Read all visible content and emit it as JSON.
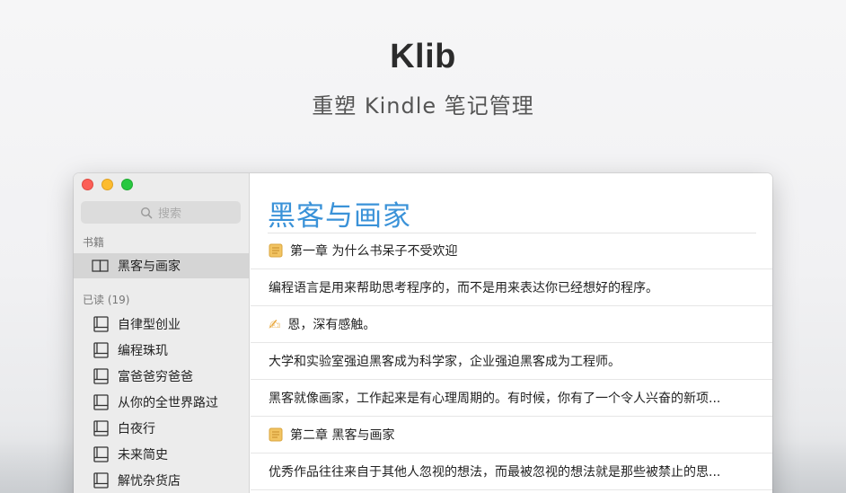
{
  "hero": {
    "title": "Klib",
    "subtitle": "重塑 Kindle 笔记管理"
  },
  "sidebar": {
    "search_placeholder": "搜索",
    "books_section": "书籍",
    "current_book": "黑客与画家",
    "read_section": "已读 (19)",
    "read_books": [
      "自律型创业",
      "编程珠玑",
      "富爸爸穷爸爸",
      "从你的全世界路过",
      "白夜行",
      "未来简史",
      "解忧杂货店"
    ]
  },
  "main": {
    "book_title": "黑客与画家",
    "rows": [
      {
        "type": "chapter",
        "text": "第一章 为什么书呆子不受欢迎"
      },
      {
        "type": "highlight",
        "text": "编程语言是用来帮助思考程序的，而不是用来表达你已经想好的程序。"
      },
      {
        "type": "note",
        "text": "恩，深有感触。"
      },
      {
        "type": "highlight",
        "text": "大学和实验室强迫黑客成为科学家，企业强迫黑客成为工程师。"
      },
      {
        "type": "highlight",
        "text": "黑客就像画家，工作起来是有心理周期的。有时候，你有了一个令人兴奋的新项..."
      },
      {
        "type": "chapter",
        "text": "第二章 黑客与画家"
      },
      {
        "type": "highlight",
        "text": "优秀作品往往来自于其他人忽视的想法，而最被忽视的想法就是那些被禁止的思..."
      }
    ]
  },
  "icons": {
    "chapter": "notepad-icon",
    "note": "writing-hand-icon",
    "book": "book-icon",
    "open_book": "open-book-icon"
  },
  "colors": {
    "accent": "#3a92d8",
    "chapter_icon": "#f2c462"
  }
}
